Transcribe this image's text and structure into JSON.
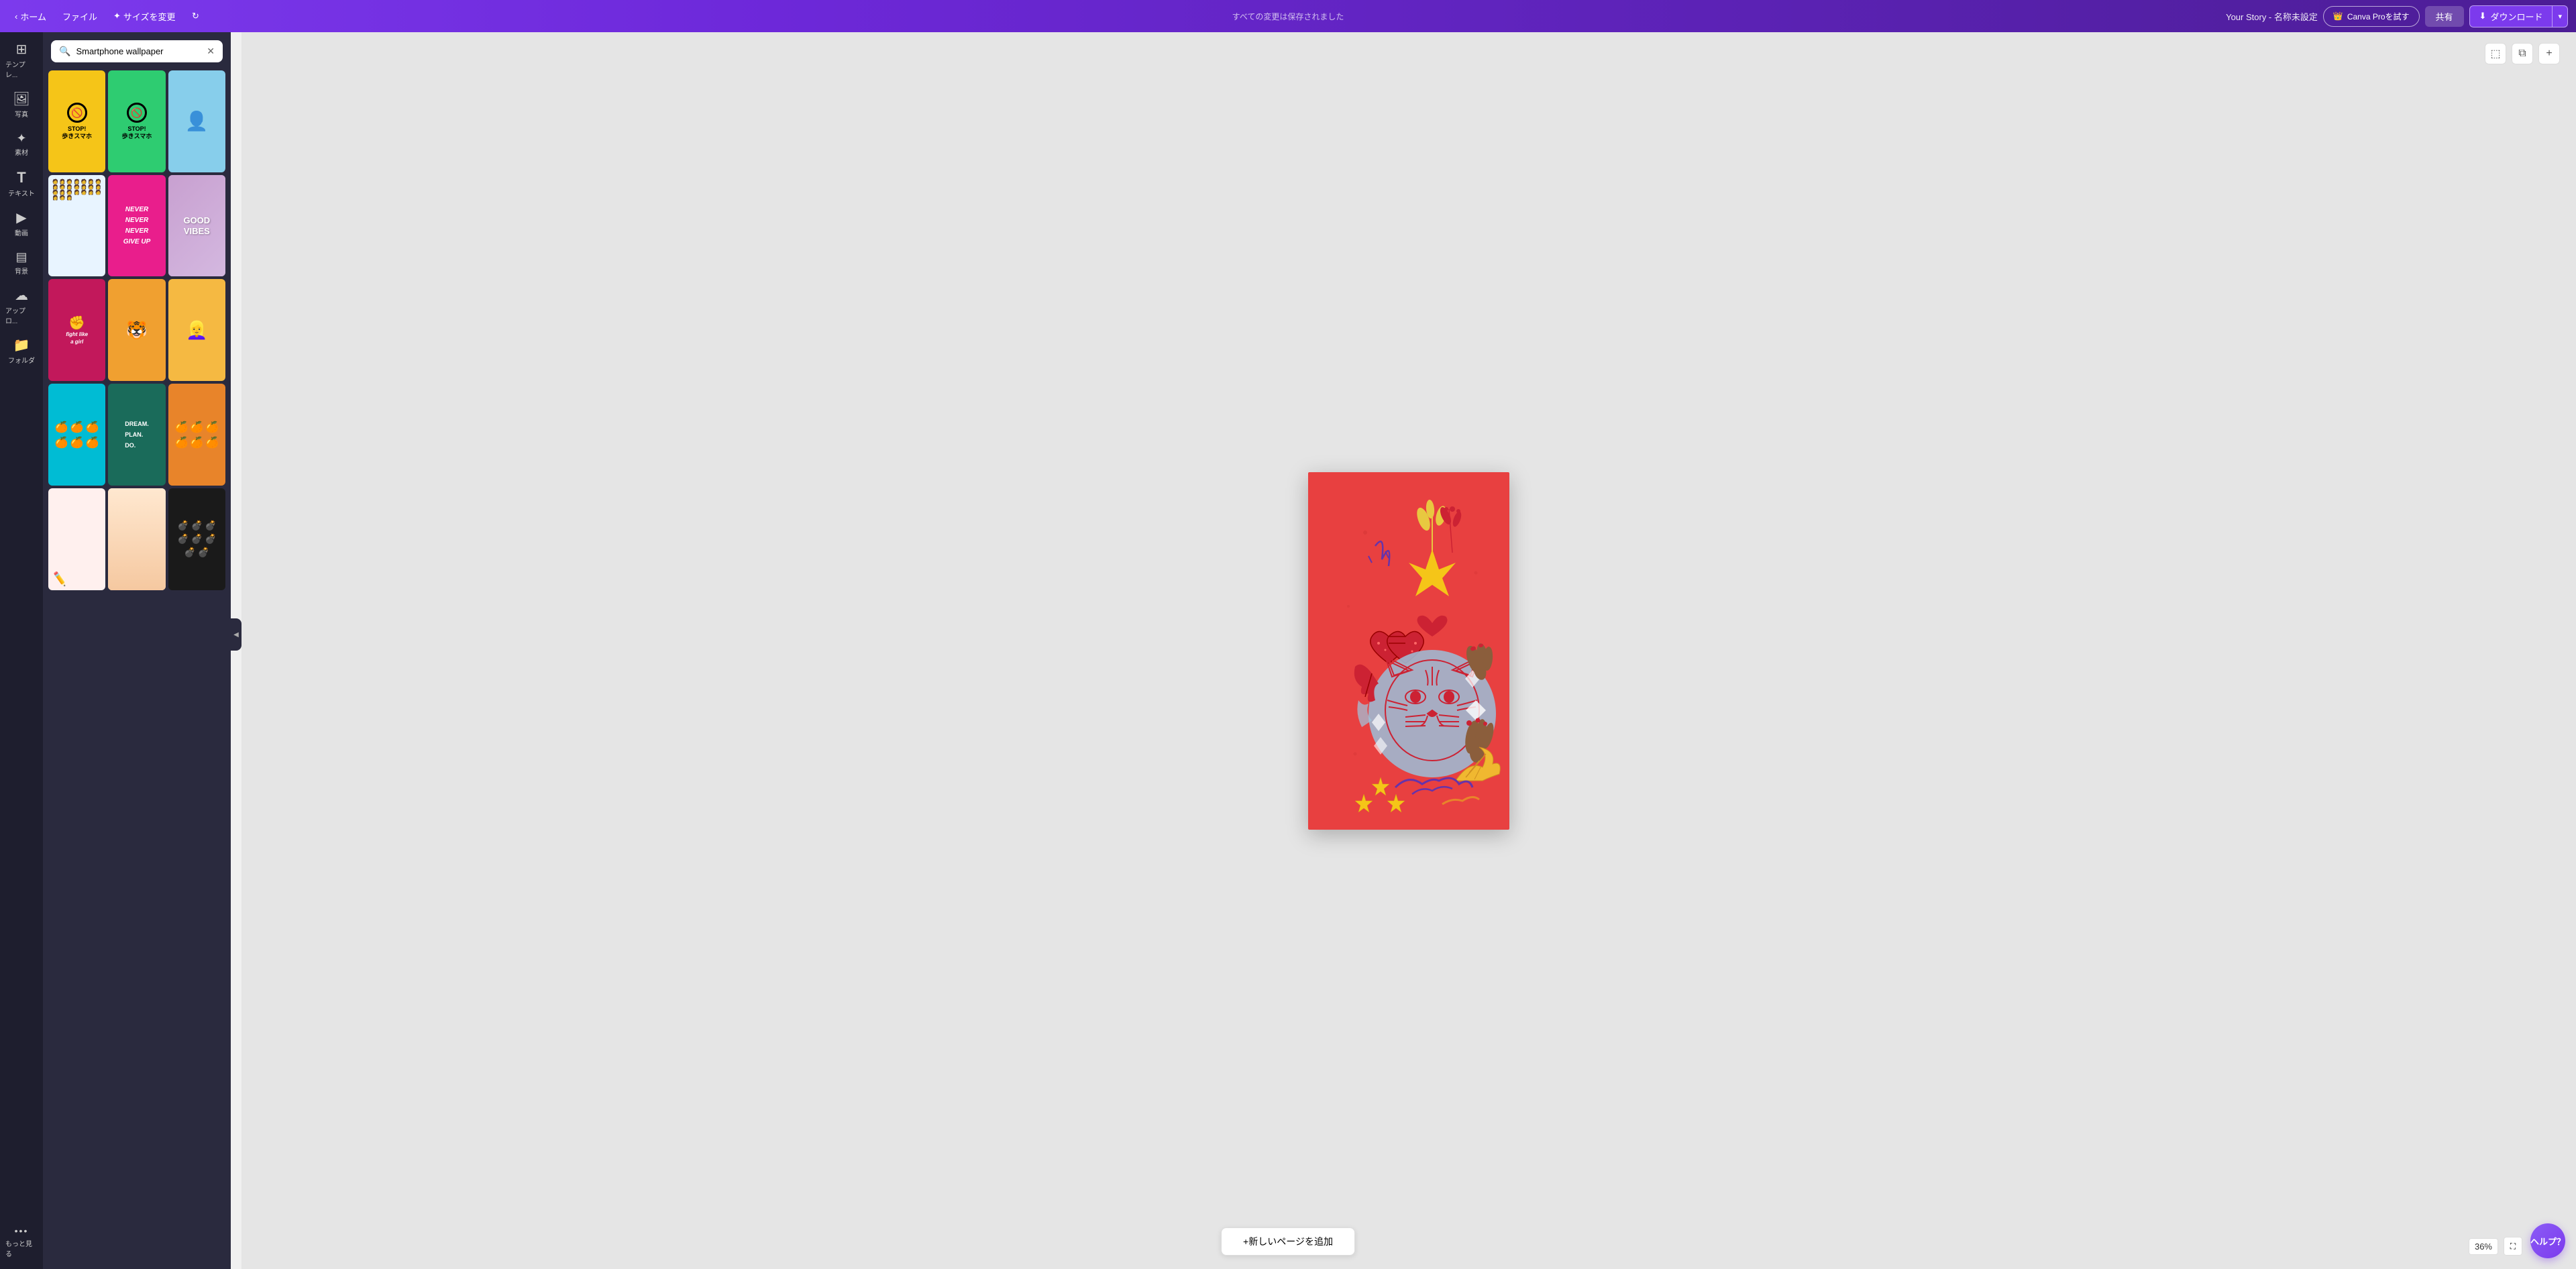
{
  "topbar": {
    "home_label": "ホーム",
    "file_label": "ファイル",
    "resize_label": "サイズを変更",
    "auto_save_label": "すべての変更は保存されました",
    "doc_title": "Your Story - 名称未設定",
    "canva_pro_label": "Canva Proを試す",
    "share_label": "共有",
    "download_label": "ダウンロード",
    "resize_icon": "✦"
  },
  "sidebar": {
    "items": [
      {
        "id": "template",
        "icon": "⊞",
        "label": "テンプレ..."
      },
      {
        "id": "photo",
        "icon": "🖼",
        "label": "写真"
      },
      {
        "id": "element",
        "icon": "❖",
        "label": "素材"
      },
      {
        "id": "text",
        "icon": "T",
        "label": "テキスト"
      },
      {
        "id": "video",
        "icon": "▶",
        "label": "動画"
      },
      {
        "id": "background",
        "icon": "≡",
        "label": "背景"
      },
      {
        "id": "upload",
        "icon": "☁",
        "label": "アップロ..."
      },
      {
        "id": "folder",
        "icon": "📁",
        "label": "フォルダ"
      },
      {
        "id": "more",
        "icon": "•••",
        "label": "もっと見る"
      }
    ]
  },
  "search": {
    "value": "Smartphone wallpaper",
    "placeholder": "Smartphone wallpaper"
  },
  "templates": [
    {
      "id": 1,
      "color": "#f5c518",
      "type": "stop1",
      "text": "STOP!\n歩きスマホ"
    },
    {
      "id": 2,
      "color": "#2ecc71",
      "type": "stop2",
      "text": "STOP!\n歩きスマホ"
    },
    {
      "id": 3,
      "color": "#87ceeb",
      "type": "blue",
      "text": ""
    },
    {
      "id": 4,
      "color": "#e8f0fe",
      "type": "people",
      "text": ""
    },
    {
      "id": 5,
      "color": "#e91e8c",
      "type": "never",
      "text": "NEVER\nNEVER\nNEVER\nGIVE UP"
    },
    {
      "id": 6,
      "color": "#c8a0d0",
      "type": "goodvibes",
      "text": "GOOD\nVIBES"
    },
    {
      "id": 7,
      "color": "#e91e8c",
      "type": "fight",
      "text": "fight like\na girl"
    },
    {
      "id": 8,
      "color": "#f5b942",
      "type": "tiger-small",
      "text": ""
    },
    {
      "id": 9,
      "color": "#f5b942",
      "type": "yellow-lady",
      "text": ""
    },
    {
      "id": 10,
      "color": "#00bcd4",
      "type": "cyan-fruit",
      "text": ""
    },
    {
      "id": 11,
      "color": "#1a6b5a",
      "type": "dream",
      "text": "DREAM.\nPLAN.\nDO."
    },
    {
      "id": 12,
      "color": "#ff8c00",
      "type": "orange-fruit",
      "text": ""
    },
    {
      "id": 13,
      "color": "#ffe4e1",
      "type": "sketch",
      "text": ""
    },
    {
      "id": 14,
      "color": "#f5deb3",
      "type": "nude",
      "text": ""
    },
    {
      "id": 15,
      "color": "#2a1a0e",
      "type": "dark-bomb",
      "text": ""
    }
  ],
  "canvas": {
    "add_page_label": "+新しいページを追加",
    "zoom_level": "36%"
  },
  "help": {
    "label": "ヘルプ？"
  },
  "controls": {
    "frame_icon": "⬚",
    "copy_icon": "⧉",
    "add_icon": "+"
  }
}
